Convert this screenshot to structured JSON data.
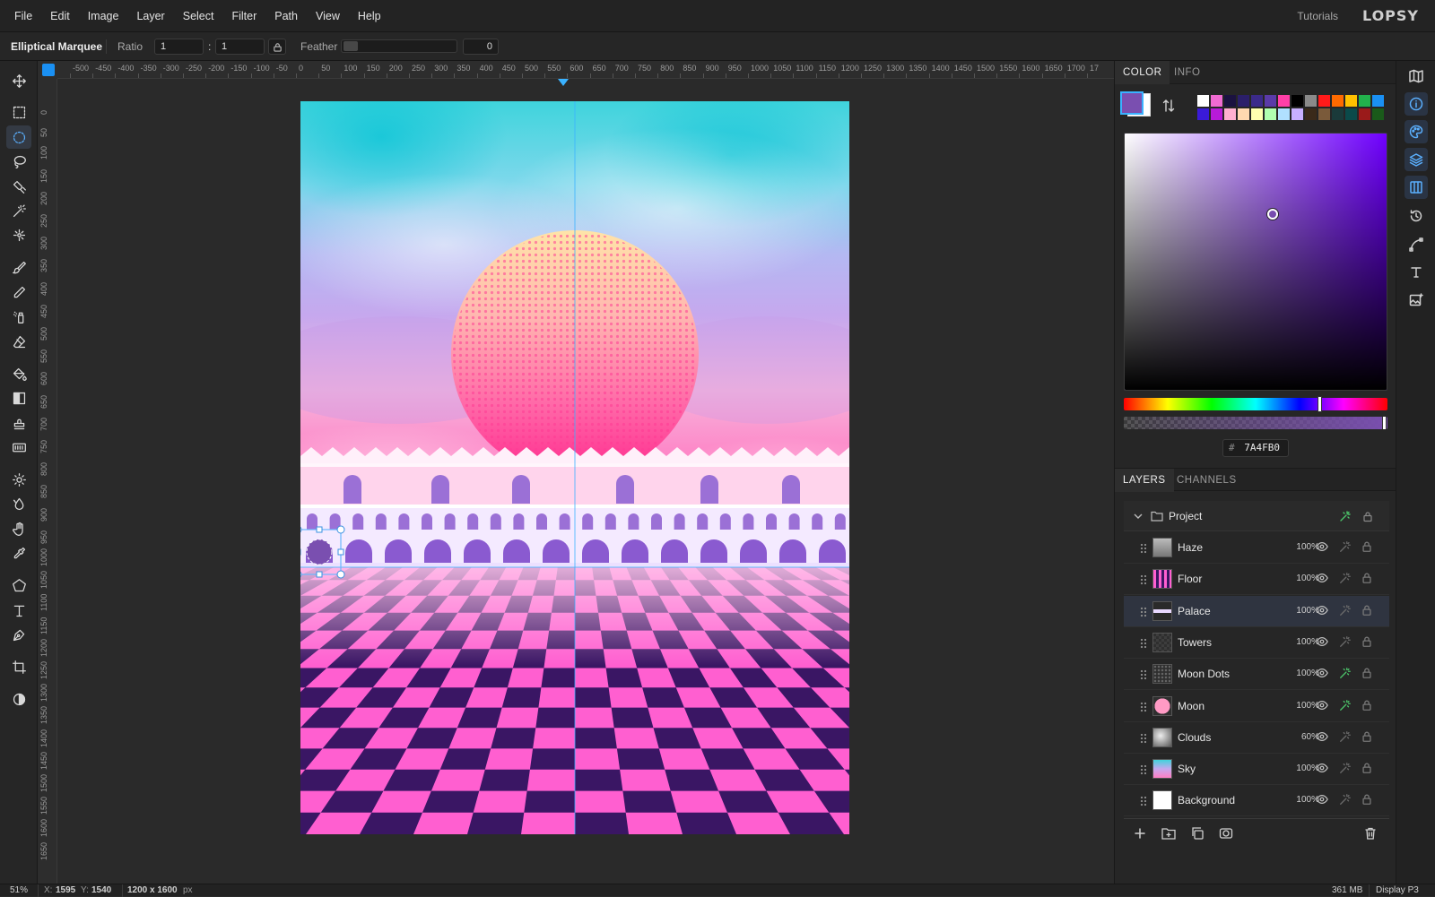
{
  "menubar": {
    "items": [
      "File",
      "Edit",
      "Image",
      "Layer",
      "Select",
      "Filter",
      "Path",
      "View",
      "Help"
    ],
    "tutorials_label": "Tutorials",
    "logo_text": "LOPSY"
  },
  "options": {
    "tool_name": "Elliptical Marquee",
    "ratio_label": "Ratio",
    "ratio_w": "1",
    "ratio_sep": ":",
    "ratio_h": "1",
    "feather_label": "Feather",
    "feather_value": "0"
  },
  "toolbox": {
    "tools": [
      "move-tool",
      "rect-marquee-tool",
      "ellipse-marquee-tool",
      "lasso-tool",
      "magnetic-lasso-tool",
      "magic-wand-tool",
      "quick-select-tool",
      "brush-tool",
      "pencil-tool",
      "spray-tool",
      "eraser-tool",
      "fill-tool",
      "gradient-tool",
      "stamp-tool",
      "pattern-tool",
      "dodge-tool",
      "blur-tool",
      "hand-tool",
      "eyedropper-tool",
      "polygon-tool",
      "text-tool",
      "pen-tool",
      "crop-tool",
      "contrast-tool"
    ],
    "active": "ellipse-marquee-tool"
  },
  "rulers": {
    "top": [
      "-500",
      "-450",
      "-400",
      "-350",
      "-300",
      "-250",
      "-200",
      "-150",
      "-100",
      "-50",
      "0",
      "50",
      "100",
      "150",
      "200",
      "250",
      "300",
      "350",
      "400",
      "450",
      "500",
      "550",
      "600",
      "650",
      "700",
      "750",
      "800",
      "850",
      "900",
      "950",
      "1000",
      "1050",
      "1100",
      "1150",
      "1200",
      "1250",
      "1300",
      "1350",
      "1400",
      "1450",
      "1500",
      "1550",
      "1600",
      "1650",
      "1700",
      "17"
    ],
    "left": [
      "0",
      "50",
      "100",
      "150",
      "200",
      "250",
      "300",
      "350",
      "400",
      "450",
      "500",
      "550",
      "600",
      "650",
      "700",
      "750",
      "800",
      "850",
      "900",
      "950",
      "1000",
      "1050",
      "1100",
      "1150",
      "1200",
      "1250",
      "1300",
      "1350",
      "1400",
      "1450",
      "1500",
      "1550",
      "1600",
      "1650"
    ]
  },
  "color_panel": {
    "tabs": [
      "COLOR",
      "INFO"
    ],
    "active_tab": "COLOR",
    "foreground": "#7A4FB0",
    "background": "#FFFFFF",
    "swatches_row1": [
      "#ffffff",
      "#f06bd2",
      "#1b1240",
      "#2b1f6a",
      "#3b2a8a",
      "#5a3aa8",
      "#ff3fa8",
      "#000000",
      "#8a8a8a",
      "#ff1a1a",
      "#ff6a00",
      "#ffc000",
      "#22b14c",
      "#1a90f3"
    ],
    "swatches_row2": [
      "#3a1ad8",
      "#b81ad8",
      "#ffb0d0",
      "#ffd8b0",
      "#ffffb0",
      "#b0ffb0",
      "#b0e0ff",
      "#c8b0ff",
      "#3a2a1a",
      "#7a5a3a",
      "#1a3a3a",
      "#0a4a4a",
      "#9a1a1a",
      "#1a5a1a"
    ],
    "hex_prefix": "#",
    "hex_value": "7A4FB0",
    "hue": 266
  },
  "layers_panel": {
    "tabs": [
      "LAYERS",
      "CHANNELS"
    ],
    "active_tab": "LAYERS",
    "group": "Project",
    "layers": [
      {
        "name": "Haze",
        "opacity": "100%"
      },
      {
        "name": "Floor",
        "opacity": "100%"
      },
      {
        "name": "Palace",
        "opacity": "100%"
      },
      {
        "name": "Towers",
        "opacity": "100%"
      },
      {
        "name": "Moon Dots",
        "opacity": "100%"
      },
      {
        "name": "Moon",
        "opacity": "100%"
      },
      {
        "name": "Clouds",
        "opacity": "60%"
      },
      {
        "name": "Sky",
        "opacity": "100%"
      },
      {
        "name": "Background",
        "opacity": "100%"
      }
    ],
    "selected": "Palace"
  },
  "statusbar": {
    "zoom": "51%",
    "x_label": "X:",
    "x_value": "1595",
    "y_label": "Y:",
    "y_value": "1540",
    "doc_size": "1200 x 1600",
    "doc_unit": "px",
    "memory": "361 MB",
    "color_profile": "Display P3"
  }
}
